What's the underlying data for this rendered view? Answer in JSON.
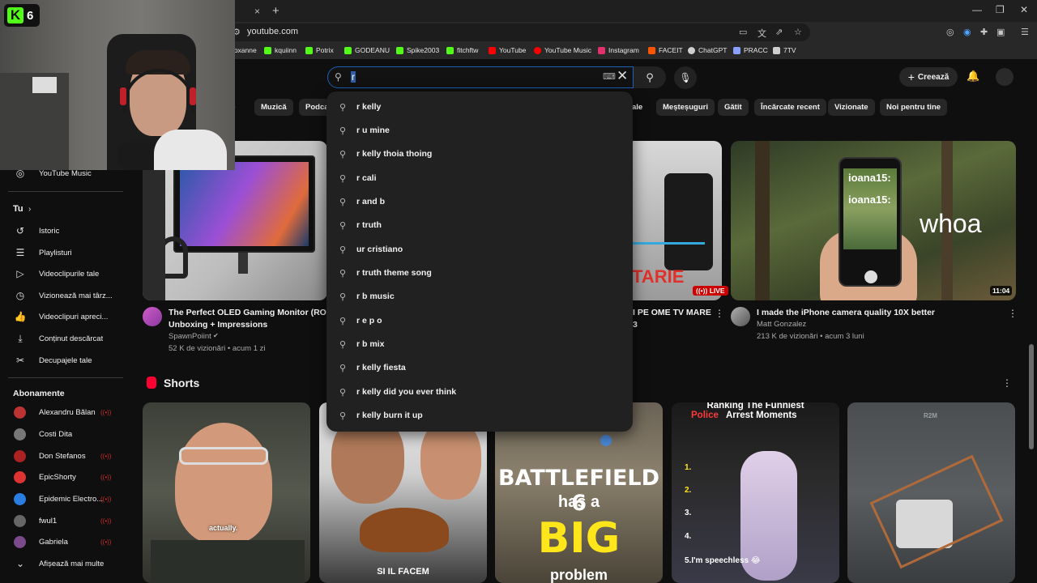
{
  "browser": {
    "tab_close": "×",
    "new_tab": "+",
    "url": "youtube.com",
    "window_controls": [
      "—",
      "❐",
      "✕"
    ],
    "bookmarks": [
      {
        "label": "roxanne",
        "color": "#8a8a8a"
      },
      {
        "label": "kquiinn",
        "color": "#53fc18"
      },
      {
        "label": "Potrix",
        "color": "#53fc18"
      },
      {
        "label": "GODEANU",
        "color": "#53fc18"
      },
      {
        "label": "Spike2003",
        "color": "#53fc18"
      },
      {
        "label": "fitchftw",
        "color": "#53fc18"
      },
      {
        "label": "YouTube",
        "color": "#ff0000"
      },
      {
        "label": "YouTube Music",
        "color": "#ff0000"
      },
      {
        "label": "Instagram",
        "color": "#e1306c"
      },
      {
        "label": "FACEIT",
        "color": "#ff5500"
      },
      {
        "label": "ChatGPT",
        "color": "#cfcfcf"
      },
      {
        "label": "PRACC",
        "color": "#8aa0ff"
      },
      {
        "label": "7TV",
        "color": "#cfcfcf"
      }
    ]
  },
  "header": {
    "search_query": "r",
    "create_label": "Creează"
  },
  "chips": [
    "ve",
    "Muzică",
    "Podca",
    "ale",
    "Meșteșuguri",
    "Gătit",
    "Încărcate recent",
    "Vizionate",
    "Noi pentru tine"
  ],
  "sidebar": {
    "top_item": "YouTube Music",
    "you_title": "Tu",
    "you_items": [
      "Istoric",
      "Playlisturi",
      "Videoclipurile tale",
      "Vizionează mai târz...",
      "Videoclipuri apreci...",
      "Conținut descărcat",
      "Decupajele tale"
    ],
    "subs_title": "Abonamente",
    "subs": [
      {
        "name": "Alexandru Bălan",
        "color": "#b33"
      },
      {
        "name": "Costi Dita",
        "color": "#777"
      },
      {
        "name": "Don Stefanos",
        "color": "#a22"
      },
      {
        "name": "EpicShorty",
        "color": "#d33"
      },
      {
        "name": "Epidemic Electro...",
        "color": "#2a7de1"
      },
      {
        "name": "fwul1",
        "color": "#666"
      },
      {
        "name": "Gabriela",
        "color": "#7a4a8a"
      }
    ],
    "show_more": "Afișează mai multe"
  },
  "videos": [
    {
      "title_line1": "The Perfect OLED Gaming Monitor (ROG",
      "title_line2": "Unboxing + Impressions",
      "channel": "SpawnPoiint",
      "meta": "52 K de vizionări • acum 1 zi"
    },
    {
      "thumb_text": "TARIE",
      "live": "LIVE",
      "title_line1": "I PE OME TV MARE",
      "title_line2": "3"
    },
    {
      "title_line1": "I made the iPhone camera quality 10X better",
      "channel": "Matt Gonzalez",
      "meta": "213 K de vizionări • acum 3 luni",
      "duration": "11:04",
      "overlay_big": "whoa",
      "overlay_small": "ioana15:"
    }
  ],
  "shorts": {
    "title": "Shorts",
    "items": [
      {
        "caption": "actually."
      },
      {
        "caption": "SI IL FACEM"
      },
      {
        "line1": "BATTLEFIELD 6",
        "line2": "has a",
        "line3": "BIG",
        "line4": "problem"
      },
      {
        "line1": "Ranking The Funniest",
        "line2a": "Police",
        "line2b": "Arrest Moments",
        "items": [
          "1.",
          "2.",
          "3.",
          "4.",
          "5.I'm speechless 😂"
        ]
      },
      {
        "caption": "R2M"
      }
    ]
  },
  "suggestions": [
    "r kelly",
    "r u mine",
    "r kelly thoia thoing",
    "r cali",
    "r and b",
    "r truth",
    "ur cristiano",
    "r truth theme song",
    "r b music",
    "r e p o",
    "r b mix",
    "r kelly fiesta",
    "r kelly did you ever think",
    "r kelly burn it up"
  ],
  "overlay": {
    "logo_letter": "K",
    "viewer_count": "6"
  },
  "colors": {
    "accent": "#1c62b9",
    "live": "#cc0000",
    "kick": "#53fc18"
  }
}
